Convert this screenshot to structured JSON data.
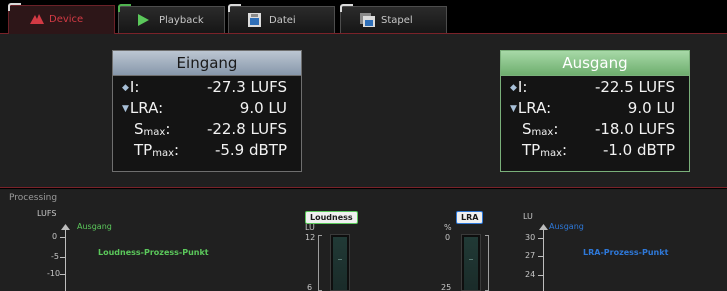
{
  "tabs": [
    {
      "label": "Device",
      "icon": "device-icon",
      "active": true
    },
    {
      "label": "Playback",
      "icon": "play-icon",
      "active": false
    },
    {
      "label": "Datei",
      "icon": "file-icon",
      "active": false
    },
    {
      "label": "Stapel",
      "icon": "stack-icon",
      "active": false
    }
  ],
  "input_box": {
    "title": "Eingang",
    "rows": [
      {
        "label": "I:",
        "value": "-27.3 LUFS"
      },
      {
        "label": "LRA:",
        "value": "9.0 LU"
      },
      {
        "label_main": "S",
        "label_sub": "max",
        "label_suffix": ":",
        "value": "-22.8 LUFS"
      },
      {
        "label_main": "TP",
        "label_sub": "max",
        "label_suffix": ":",
        "value": "-5.9 dBTP"
      }
    ]
  },
  "output_box": {
    "title": "Ausgang",
    "rows": [
      {
        "label": "I:",
        "value": "-22.5 LUFS"
      },
      {
        "label": "LRA:",
        "value": "9.0 LU"
      },
      {
        "label_main": "S",
        "label_sub": "max",
        "label_suffix": ":",
        "value": "-18.0 LUFS"
      },
      {
        "label_main": "TP",
        "label_sub": "max",
        "label_suffix": ":",
        "value": "-1.0 dBTP"
      }
    ]
  },
  "processing": {
    "title": "Processing",
    "loudness_graph": {
      "unit": "LUFS",
      "series_label": "Ausgang",
      "point_label": "Loudness-Prozess-Punkt",
      "ticks": [
        "0",
        "-5",
        "-10"
      ]
    },
    "loudness_meter": {
      "chip": "Loudness",
      "unit": "LU",
      "ticks": [
        "12",
        "6"
      ]
    },
    "lra_meter": {
      "chip": "LRA",
      "unit": "%",
      "ticks": [
        "0",
        "25"
      ]
    },
    "lra_graph": {
      "unit": "LU",
      "series_label": "Ausgang",
      "point_label": "LRA-Prozess-Punkt",
      "ticks": [
        "30",
        "27",
        "24"
      ]
    }
  },
  "colors": {
    "accent_red": "#d23a44",
    "output_green": "#6eae6e",
    "input_blue_grey": "#8797ab",
    "lra_blue": "#2e78d8"
  }
}
